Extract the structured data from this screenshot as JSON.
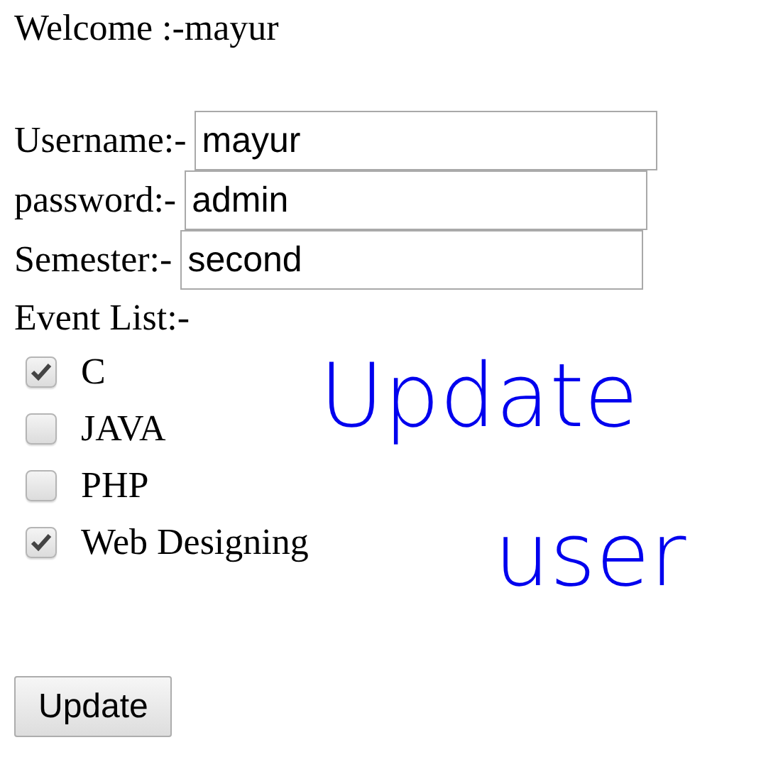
{
  "welcome": "Welcome :-mayur",
  "fields": [
    {
      "label": "Username:-",
      "value": "mayur"
    },
    {
      "label": "password:-",
      "value": "admin"
    },
    {
      "label": "Semester:-",
      "value": "second"
    }
  ],
  "events": {
    "label": "Event List:-",
    "items": [
      {
        "label": "C",
        "checked": true
      },
      {
        "label": "JAVA",
        "checked": false
      },
      {
        "label": "PHP",
        "checked": false
      },
      {
        "label": "Web Designing",
        "checked": true
      }
    ]
  },
  "button": "Update",
  "annotation": [
    "Update",
    "user"
  ]
}
